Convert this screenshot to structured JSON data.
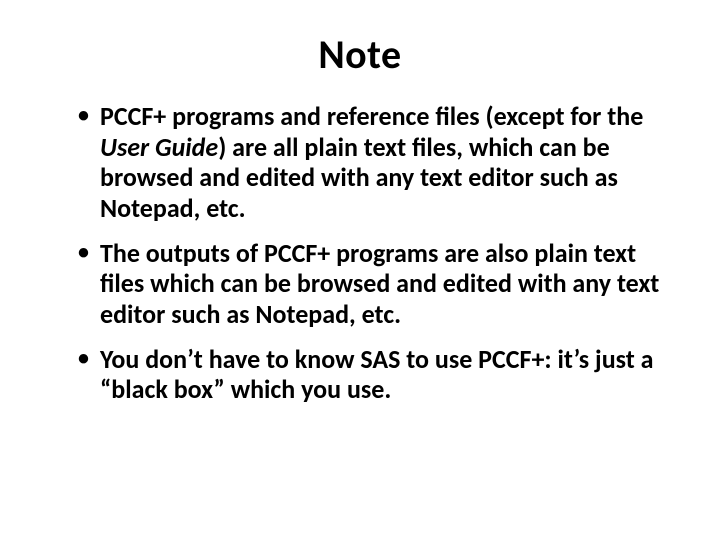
{
  "title": "Note",
  "bullets": [
    {
      "pre": "PCCF+ programs and reference files (except for the ",
      "italic": "User Guide",
      "post": ") are all plain text files, which can be browsed and edited with any text editor such as Notepad, etc."
    },
    {
      "pre": "The outputs of PCCF+ programs are also plain text files which can be browsed and edited with any text editor such as Notepad, etc.",
      "italic": "",
      "post": ""
    },
    {
      "pre": "You don’t have to know SAS to use PCCF+: it’s just a “black box” which you use.",
      "italic": "",
      "post": ""
    }
  ]
}
